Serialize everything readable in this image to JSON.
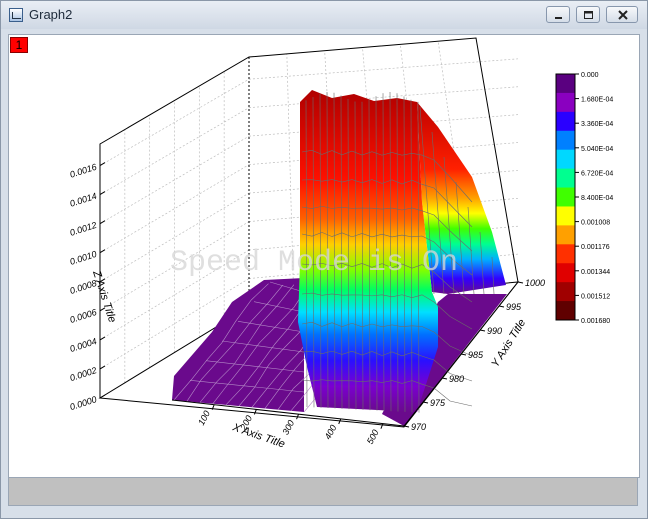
{
  "window": {
    "title": "Graph2"
  },
  "layer": {
    "number": "1"
  },
  "watermark": "Speed Mode is On",
  "axes": {
    "x_title": "X Axis Title",
    "y_title": "Y Axis Title",
    "z_title": "Z Axis Title",
    "x_ticks": [
      "100",
      "200",
      "300",
      "400",
      "500"
    ],
    "y_ticks": [
      "970",
      "975",
      "980",
      "985",
      "990",
      "995",
      "1000"
    ],
    "z_ticks": [
      "0.0000",
      "0.0002",
      "0.0004",
      "0.0006",
      "0.0008",
      "0.0010",
      "0.0012",
      "0.0014",
      "0.0016"
    ]
  },
  "colorbar": {
    "labels": [
      "0.000",
      "1.680E-04",
      "3.360E-04",
      "5.040E-04",
      "6.720E-04",
      "8.400E-04",
      "0.001008",
      "0.001176",
      "0.001344",
      "0.001512",
      "0.001680"
    ],
    "colors": [
      "#5a0080",
      "#8a00c0",
      "#2a00ff",
      "#0080ff",
      "#00d8ff",
      "#00ff90",
      "#40ff00",
      "#ffff00",
      "#ffa000",
      "#ff3000",
      "#e00000",
      "#a00000",
      "#600000"
    ]
  },
  "chart_data": {
    "type": "surface",
    "xlabel": "X Axis Title",
    "ylabel": "Y Axis Title",
    "zlabel": "Z Axis Title",
    "xlim": [
      0,
      550
    ],
    "ylim": [
      970,
      1000
    ],
    "zlim": [
      0,
      0.00168
    ],
    "z_plateau": 0.0016,
    "x_ridge": [
      235,
      300
    ]
  }
}
